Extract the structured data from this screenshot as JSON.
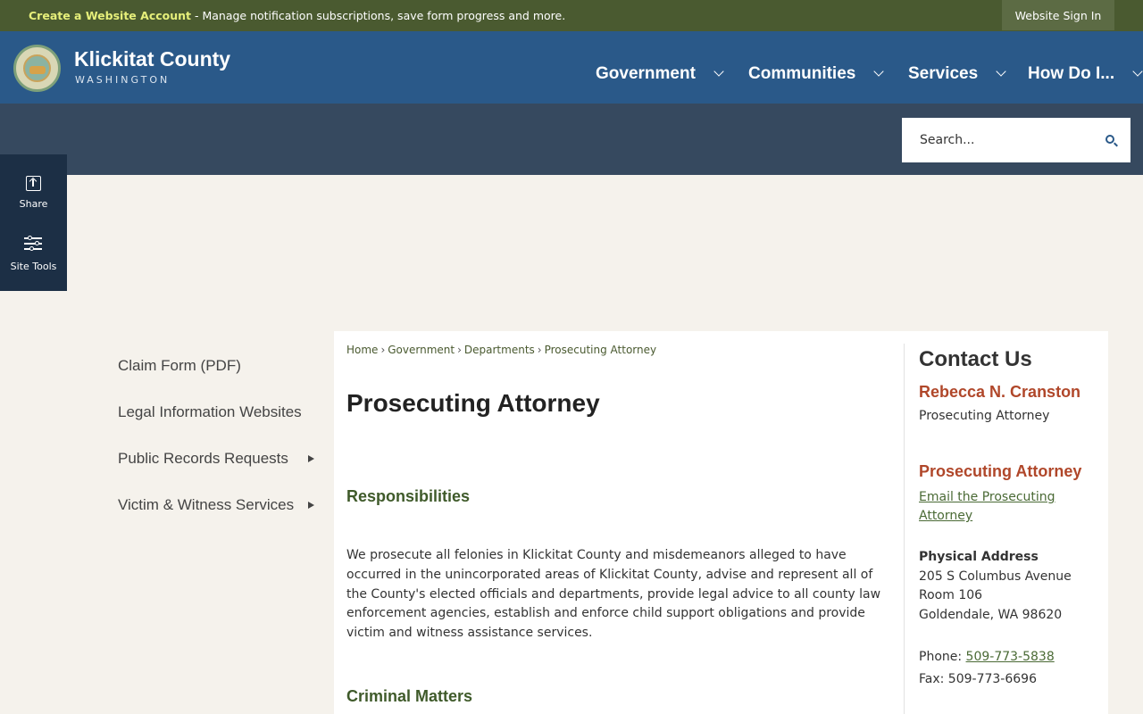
{
  "topbar": {
    "account_link": "Create a Website Account",
    "message": " - Manage notification subscriptions, save form progress and more.",
    "sign_in": "Website Sign In"
  },
  "header": {
    "site_name": "Klickitat County",
    "site_sub": "WASHINGTON",
    "nav": [
      "Government",
      "Communities",
      "Services",
      "How Do I..."
    ]
  },
  "search": {
    "placeholder": "Search..."
  },
  "sidetools": {
    "share": "Share",
    "tools": "Site Tools"
  },
  "leftnav": {
    "items": [
      "Claim Form (PDF)",
      "Legal Information Websites",
      "Public Records Requests",
      "Victim & Witness Services"
    ]
  },
  "breadcrumb": [
    "Home",
    "Government",
    "Departments",
    "Prosecuting Attorney"
  ],
  "page": {
    "title": "Prosecuting Attorney",
    "section1_heading": "Responsibilities",
    "section1_text": "We prosecute all felonies in Klickitat County and misdemeanors alleged to have occurred in the unincorporated areas of Klickitat County, advise and represent all of the County's elected officials and departments, provide legal advice to all county law enforcement agencies, establish and enforce child support obligations and provide victim and witness assistance services.",
    "section2_heading": "Criminal Matters"
  },
  "contact": {
    "title": "Contact Us",
    "name": "Rebecca N. Cranston",
    "role": "Prosecuting Attorney",
    "dept": "Prosecuting Attorney",
    "email_link": "Email the Prosecuting Attorney",
    "address_label": "Physical Address",
    "address": [
      "205 S Columbus Avenue",
      "Room 106",
      "Goldendale, WA 98620"
    ],
    "phone_label": "Phone: ",
    "phone": "509-773-5838",
    "fax": "Fax: 509-773-6696"
  },
  "colors": {
    "topbar": "#4a5a30",
    "header": "#2a5989",
    "search_strip": "#36495f",
    "side_tools": "#1c2f45",
    "heading_green": "#3f5a2a",
    "contact_accent": "#b0472a"
  }
}
